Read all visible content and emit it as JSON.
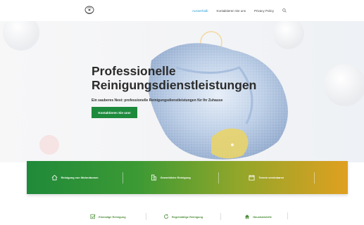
{
  "header": {
    "nav": [
      {
        "label": "Ausserhalb",
        "active": true
      },
      {
        "label": "Kontaktieren Sie uns",
        "active": false
      },
      {
        "label": "Privacy Policy",
        "active": false
      }
    ],
    "search_icon": "search-icon",
    "accent_color": "#2e9fd8"
  },
  "hero": {
    "title_line1": "Professionelle",
    "title_line2": "Reinigungsdienstleistungen",
    "subtitle": "Ein sauberes Nest: professionelle Reinigungsdienstleistungen für Ihr Zuhause",
    "cta_label": "Kontaktieren Sie uns!",
    "cta_color": "#1e8a3c"
  },
  "features": [
    {
      "icon": "house-icon",
      "label": "Reinigung von Wohnräumen"
    },
    {
      "icon": "building-icon",
      "label": "Gewerbliche Reinigung"
    },
    {
      "icon": "calendar-icon",
      "label": "Termin vereinbaren"
    }
  ],
  "services": [
    {
      "icon": "checklist-icon",
      "label": "Einmalige Reinigung"
    },
    {
      "icon": "refresh-icon",
      "label": "Regelmäßige Reinigung"
    },
    {
      "icon": "home-icon",
      "label": "Haushaltshilfe"
    }
  ]
}
